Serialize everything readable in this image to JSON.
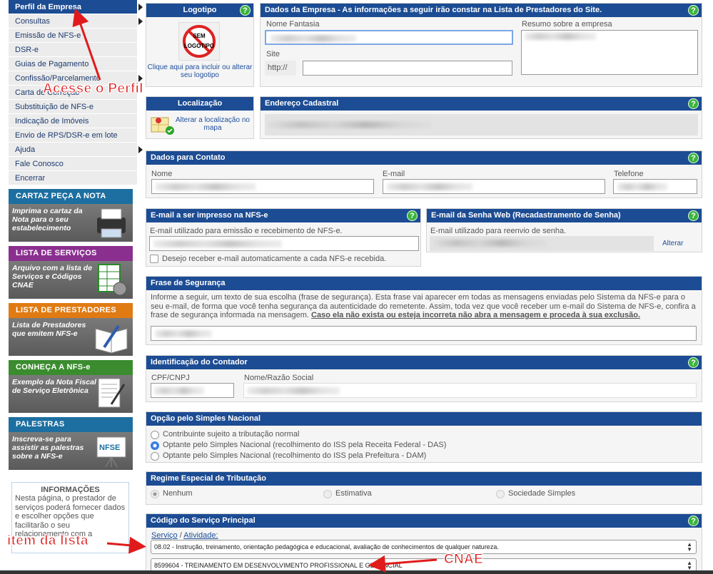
{
  "menu": {
    "items": [
      {
        "label": "Perfil da Empresa",
        "active": true,
        "arrow": true
      },
      {
        "label": "Consultas",
        "arrow": true
      },
      {
        "label": "Emissão de NFS-e"
      },
      {
        "label": "DSR-e"
      },
      {
        "label": "Guias de Pagamento"
      },
      {
        "label": "Confissão/Parcelamento",
        "arrow": true
      },
      {
        "label": "Carta de Correção",
        "arrow": false
      },
      {
        "label": "Substituição de NFS-e"
      },
      {
        "label": "Indicação de Imóveis"
      },
      {
        "label": "Envio de RPS/DSR-e em lote"
      },
      {
        "label": "Ajuda",
        "arrow": true
      },
      {
        "label": "Fale Conosco"
      },
      {
        "label": "Encerrar"
      }
    ]
  },
  "banners": [
    {
      "title": "CARTAZ PEÇA A NOTA",
      "text": "Imprima o cartaz da Nota para o seu estabelecimento",
      "color": "#1c6fa0",
      "icon": "printer-icon"
    },
    {
      "title": "LISTA DE SERVIÇOS",
      "text": "Arquivo com a lista de Serviços e Códigos CNAE",
      "color": "#8a2f8f",
      "icon": "spreadsheet-gear-icon"
    },
    {
      "title": "LISTA DE PRESTADORES",
      "text": "Lista de Prestadores que emitem NFS-e",
      "color": "#e07a12",
      "icon": "book-pen-icon"
    },
    {
      "title": "CONHEÇA A NFS-e",
      "text": "Exemplo da Nota Fiscal de Serviço Eletrônica",
      "color": "#3a8c2e",
      "icon": "document-pen-icon"
    },
    {
      "title": "PALESTRAS",
      "text": "Inscreva-se para assistir as palestras sobre a NFS-e",
      "color": "#1c6fa0",
      "icon": "nfse-board-icon"
    }
  ],
  "info": {
    "title": "INFORMAÇÕES",
    "text": "Nesta página, o prestador de serviços poderá fornecer dados e escolher opções que facilitarão o seu relacionamento com a"
  },
  "annotations": {
    "perfil": "Acesse o Perfil",
    "item": "item da lista",
    "cnae": "CNAE"
  },
  "logo": {
    "title": "Logotipo",
    "placeholder_line1": "SEM",
    "placeholder_line2": "LOGOTIPO",
    "link": "Clique aqui para incluir ou alterar seu logotipo"
  },
  "empresa": {
    "title": "Dados da Empresa - As informações a seguir irão constar na Lista de Prestadores do Site.",
    "nome_fantasia_label": "Nome Fantasia",
    "nome_fantasia_value": "",
    "resumo_label": "Resumo sobre a empresa",
    "site_label": "Site",
    "site_prefix": "http://"
  },
  "localizacao": {
    "title": "Localização",
    "link": "Alterar a localização no mapa"
  },
  "endereco": {
    "title": "Endereço Cadastral"
  },
  "contato": {
    "title": "Dados para Contato",
    "nome_label": "Nome",
    "email_label": "E-mail",
    "telefone_label": "Telefone"
  },
  "email_nfse": {
    "title": "E-mail a ser impresso na NFS-e",
    "desc": "E-mail utilizado para emissão e recebimento de NFS-e.",
    "checkbox_label": "Desejo receber e-mail automaticamente a cada NFS-e recebida."
  },
  "email_senha": {
    "title": "E-mail da Senha Web (Recadastramento de Senha)",
    "desc": "E-mail utilizado para reenvio de senha.",
    "alterar": "Alterar"
  },
  "frase": {
    "title": "Frase de Segurança",
    "text": "Informe a seguir, um texto de sua escolha (frase de segurança). Esta frase vai aparecer em todas as mensagens enviadas pelo Sistema da NFS-e para o seu e-mail, de forma que você tenha segurança da autenticidade do remetente. Assim, toda vez que você receber um e-mail do Sistema de NFS-e, confira a frase de segurança informada na mensagem.",
    "warning": "Caso ela não exista ou esteja incorreta não abra a mensagem e proceda à sua exclusão."
  },
  "contador": {
    "title": "Identificação do Contador",
    "cpf_label": "CPF/CNPJ",
    "nome_label": "Nome/Razão Social"
  },
  "simples": {
    "title": "Opção pelo Simples Nacional",
    "options": [
      {
        "label": "Contribuinte sujeito a tributação normal",
        "selected": false
      },
      {
        "label": "Optante pelo Simples Nacional (recolhimento do ISS pela Receita Federal - DAS)",
        "selected": true
      },
      {
        "label": "Optante pelo Simples Nacional (recolhimento do ISS pela Prefeitura - DAM)",
        "selected": false
      }
    ]
  },
  "regime": {
    "title": "Regime Especial de Tributação",
    "options": [
      {
        "label": "Nenhum",
        "selected": true
      },
      {
        "label": "Estimativa",
        "selected": false
      },
      {
        "label": "Sociedade Simples",
        "selected": false
      }
    ]
  },
  "servico": {
    "title": "Código do Serviço Principal",
    "servico_link": "Serviço",
    "separator": "/",
    "atividade_link": "Atividade:",
    "servico_value": "08.02 - Instrução, treinamento, orientação pedagógica e educacional, avaliação de conhecimentos de qualquer natureza.",
    "atividade_value": "8599604 - TREINAMENTO EM DESENVOLVIMENTO PROFISSIONAL E GERENCIAL"
  },
  "help_icon": "?",
  "colors": {
    "header": "#1c4c93",
    "help": "#3bb33b",
    "annotation": "#e11b1b"
  }
}
